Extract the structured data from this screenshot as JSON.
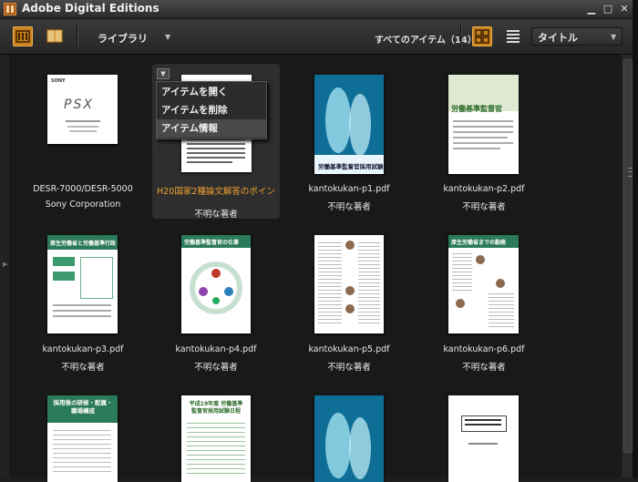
{
  "window": {
    "title": "Adobe Digital Editions"
  },
  "toolbar": {
    "library_label": "ライブラリ",
    "count_label": "すべてのアイテム（14）",
    "sort_label": "タイトル"
  },
  "context_menu": {
    "items": [
      "アイテムを開く",
      "アイテムを削除",
      "アイテム情報"
    ],
    "hovered_index": 2
  },
  "items": [
    {
      "title": "DESR-7000/DESR-5000",
      "author": "Sony Corporation"
    },
    {
      "title": "H20国家2種論文解答のポイン",
      "author": "不明な著者"
    },
    {
      "title": "kantokukan-p1.pdf",
      "author": "不明な著者"
    },
    {
      "title": "kantokukan-p2.pdf",
      "author": "不明な著者"
    },
    {
      "title": "kantokukan-p3.pdf",
      "author": "不明な著者"
    },
    {
      "title": "kantokukan-p4.pdf",
      "author": "不明な著者"
    },
    {
      "title": "kantokukan-p5.pdf",
      "author": "不明な著者"
    },
    {
      "title": "kantokukan-p6.pdf",
      "author": "不明な著者"
    },
    {
      "title": "",
      "author": ""
    },
    {
      "title": "",
      "author": ""
    },
    {
      "title": "",
      "author": ""
    },
    {
      "title": "",
      "author": ""
    }
  ],
  "covers": {
    "psx_brand": "SONY",
    "psx_logo": "PSX",
    "p1_heading": "労働基準監督官採用試験",
    "p2_heading": "労働基準監督官",
    "p3_heading": "厚生労働省と労働基準行政",
    "p4_heading": "労働基準監督官の仕事",
    "p6_heading": "厚生労働省までの勤務",
    "r3_1_heading": "採用後の研修・配属・職場構成",
    "r3_2_heading": "平成19年度 労働基準監督官採用試験日程"
  },
  "colors": {
    "accent": "#c9811d",
    "selected_title": "#f0a030"
  }
}
